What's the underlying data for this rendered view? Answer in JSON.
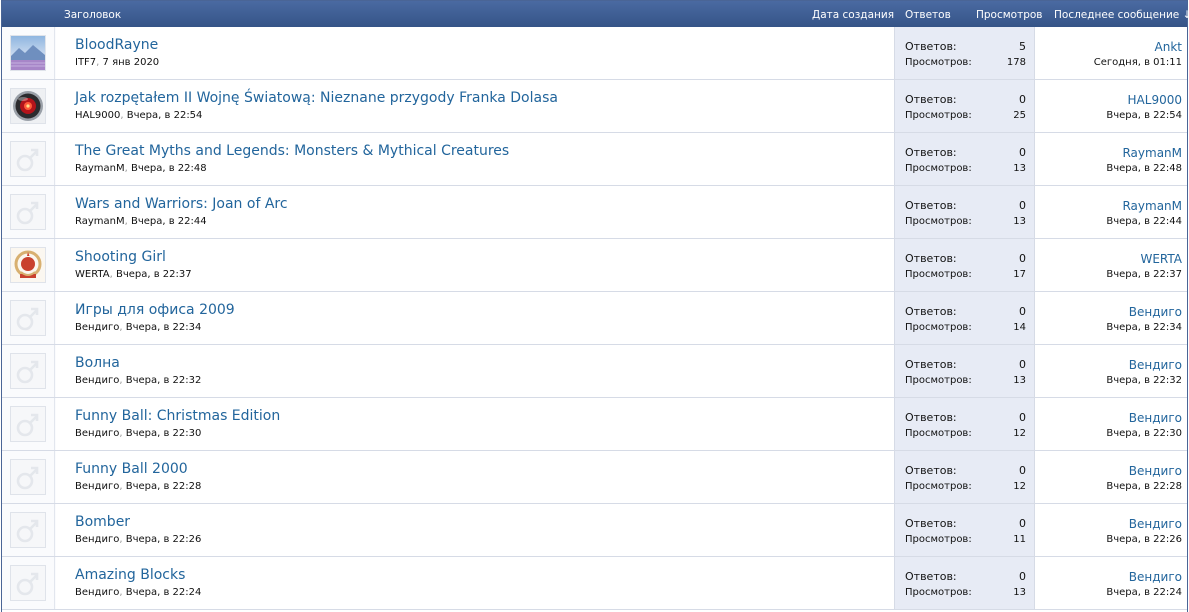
{
  "header": {
    "title": "Заголовок",
    "created": "Дата создания",
    "replies": "Ответов",
    "views": "Просмотров",
    "last_message": "Последнее сообщение ↓"
  },
  "labels": {
    "replies": "Ответов:",
    "views": "Просмотров:",
    "meta_sep": ","
  },
  "threads": [
    {
      "title": "BloodRayne",
      "author": "ITF7",
      "date": "7 янв 2020",
      "replies": "5",
      "views": "178",
      "last_user": "Ankt",
      "last_date": "Сегодня, в 01:11",
      "avatar": "landscape-avatar"
    },
    {
      "title": "Jak rozpętałem II Wojnę Światową: Nieznane przygody Franka Dolasa",
      "author": "HAL9000",
      "date": "Вчера, в 22:54",
      "replies": "0",
      "views": "25",
      "last_user": "HAL9000",
      "last_date": "Вчера, в 22:54",
      "avatar": "hal9000-eye-avatar"
    },
    {
      "title": "The Great Myths and Legends: Monsters & Mythical Creatures",
      "author": "RaymanM",
      "date": "Вчера, в 22:48",
      "replies": "0",
      "views": "13",
      "last_user": "RaymanM",
      "last_date": "Вчера, в 22:48",
      "avatar": "default-male-avatar"
    },
    {
      "title": "Wars and Warriors: Joan of Arc",
      "author": "RaymanM",
      "date": "Вчера, в 22:44",
      "replies": "0",
      "views": "13",
      "last_user": "RaymanM",
      "last_date": "Вчера, в 22:44",
      "avatar": "default-male-avatar"
    },
    {
      "title": "Shooting Girl",
      "author": "WERTA",
      "date": "Вчера, в 22:37",
      "replies": "0",
      "views": "17",
      "last_user": "WERTA",
      "last_date": "Вчера, в 22:37",
      "avatar": "emblem-avatar"
    },
    {
      "title": "Игры для офиса 2009",
      "author": "Вендиго",
      "date": "Вчера, в 22:34",
      "replies": "0",
      "views": "14",
      "last_user": "Вендиго",
      "last_date": "Вчера, в 22:34",
      "avatar": "default-male-avatar"
    },
    {
      "title": "Волна",
      "author": "Вендиго",
      "date": "Вчера, в 22:32",
      "replies": "0",
      "views": "13",
      "last_user": "Вендиго",
      "last_date": "Вчера, в 22:32",
      "avatar": "default-male-avatar"
    },
    {
      "title": "Funny Ball: Christmas Edition",
      "author": "Вендиго",
      "date": "Вчера, в 22:30",
      "replies": "0",
      "views": "12",
      "last_user": "Вендиго",
      "last_date": "Вчера, в 22:30",
      "avatar": "default-male-avatar"
    },
    {
      "title": "Funny Ball 2000",
      "author": "Вендиго",
      "date": "Вчера, в 22:28",
      "replies": "0",
      "views": "12",
      "last_user": "Вендиго",
      "last_date": "Вчера, в 22:28",
      "avatar": "default-male-avatar"
    },
    {
      "title": "Bomber",
      "author": "Вендиго",
      "date": "Вчера, в 22:26",
      "replies": "0",
      "views": "11",
      "last_user": "Вендиго",
      "last_date": "Вчера, в 22:26",
      "avatar": "default-male-avatar"
    },
    {
      "title": "Amazing Blocks",
      "author": "Вендиго",
      "date": "Вчера, в 22:24",
      "replies": "0",
      "views": "13",
      "last_user": "Вендиго",
      "last_date": "Вчера, в 22:24",
      "avatar": "default-male-avatar"
    }
  ]
}
